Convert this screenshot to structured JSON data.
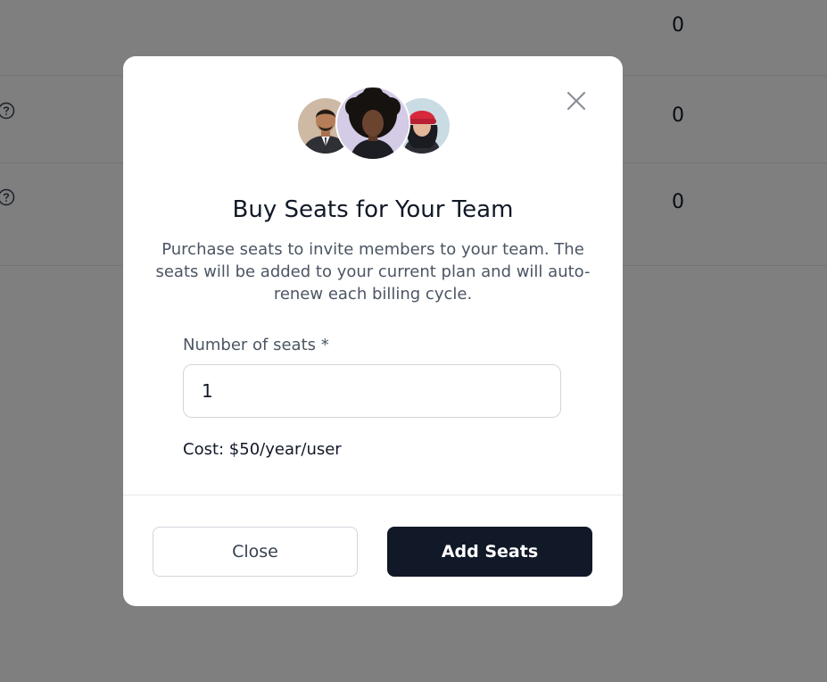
{
  "background": {
    "rows": [
      {
        "count": "0",
        "has_help_icon": false
      },
      {
        "count": "0",
        "has_help_icon": true
      },
      {
        "count": "0",
        "has_help_icon": true
      }
    ],
    "help_icon": "question-circle-icon"
  },
  "modal": {
    "title": "Buy Seats for Your Team",
    "description": "Purchase seats to invite members to your team. The seats will be added to your current plan and will auto-renew each billing cycle.",
    "close_icon": "close-icon",
    "avatars": [
      "avatar-man-suit",
      "avatar-woman-curly-hair",
      "avatar-woman-red-beanie"
    ],
    "seats_field": {
      "label": "Number of seats *",
      "value": "1"
    },
    "cost": "Cost: $50/year/user",
    "buttons": {
      "close": "Close",
      "add": "Add Seats"
    }
  },
  "colors": {
    "overlay": "#808080",
    "primary_button": "#111827",
    "text_muted": "#4b5563"
  }
}
